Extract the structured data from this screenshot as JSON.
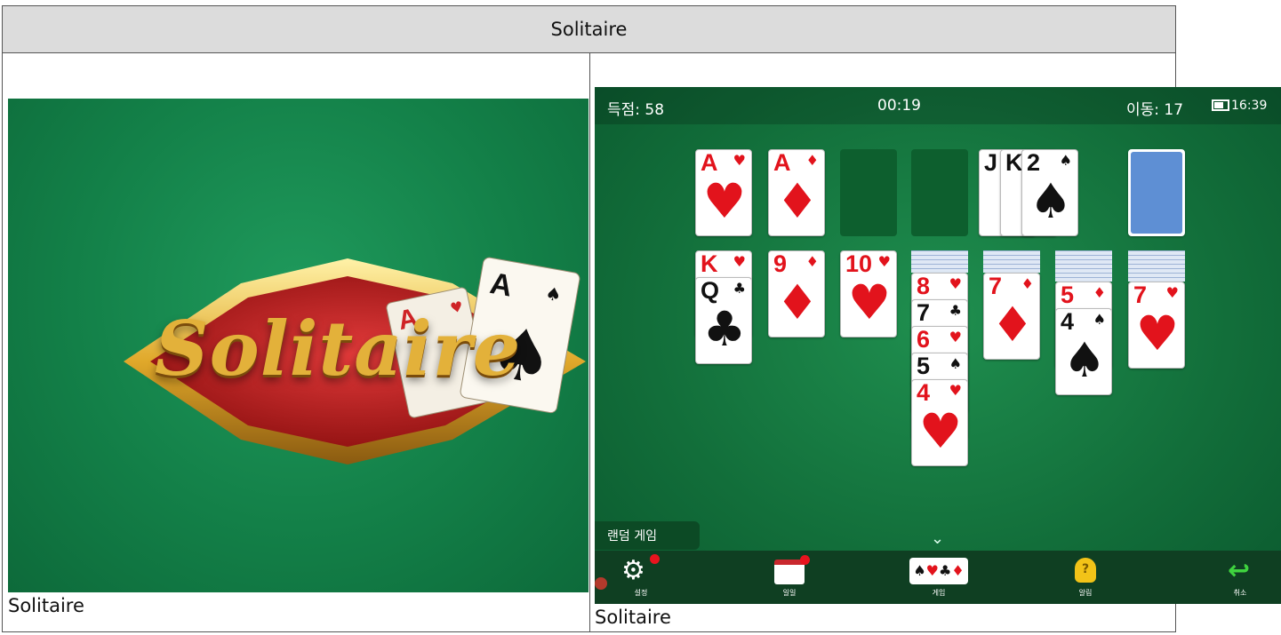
{
  "header": {
    "title": "Solitaire"
  },
  "left": {
    "logo_text": "Solitaire",
    "caption": "Solitaire",
    "logo_cards": [
      {
        "rank": "A",
        "suit": "♥",
        "color": "red"
      },
      {
        "rank": "A",
        "suit": "♠",
        "color": "black"
      }
    ]
  },
  "right": {
    "caption": "Solitaire",
    "status": {
      "score": "득점: 58",
      "time": "00:19",
      "moves": "이동: 17",
      "clock": "16:39"
    },
    "foundations": [
      {
        "rank": "A",
        "suit": "♥",
        "color": "red"
      },
      {
        "rank": "A",
        "suit": "♦",
        "color": "red"
      }
    ],
    "waste": [
      {
        "rank": "J"
      },
      {
        "rank": "K"
      },
      {
        "rank": "2",
        "suit": "♠",
        "color": "black"
      }
    ],
    "tableau": [
      [
        {
          "rank": "K",
          "suit": "♥",
          "color": "red"
        },
        {
          "rank": "Q",
          "suit": "♣",
          "color": "black"
        }
      ],
      [
        {
          "rank": "9",
          "suit": "♦",
          "color": "red"
        }
      ],
      [
        {
          "rank": "10",
          "suit": "♥",
          "color": "red"
        }
      ],
      [
        {
          "rank": "8",
          "suit": "♥",
          "color": "red"
        },
        {
          "rank": "7",
          "suit": "♣",
          "color": "black"
        },
        {
          "rank": "6",
          "suit": "♥",
          "color": "red"
        },
        {
          "rank": "5",
          "suit": "♠",
          "color": "black"
        },
        {
          "rank": "4",
          "suit": "♥",
          "color": "red"
        }
      ],
      [
        {
          "rank": "7",
          "suit": "♦",
          "color": "red"
        }
      ],
      [
        {
          "rank": "5",
          "suit": "♦",
          "color": "red"
        },
        {
          "rank": "4",
          "suit": "♠",
          "color": "black"
        }
      ],
      [
        {
          "rank": "7",
          "suit": "♥",
          "color": "red"
        }
      ]
    ],
    "random_game_label": "랜덤 게임",
    "toolbar": {
      "settings": "설정",
      "daily": "일일",
      "games": "게임",
      "hint": "알림",
      "undo": "취소"
    }
  },
  "colors": {
    "felt": "#138048",
    "red_suit": "#e2131c",
    "toolbar_bg": "#0f3f22",
    "badge": "#e8141e"
  }
}
